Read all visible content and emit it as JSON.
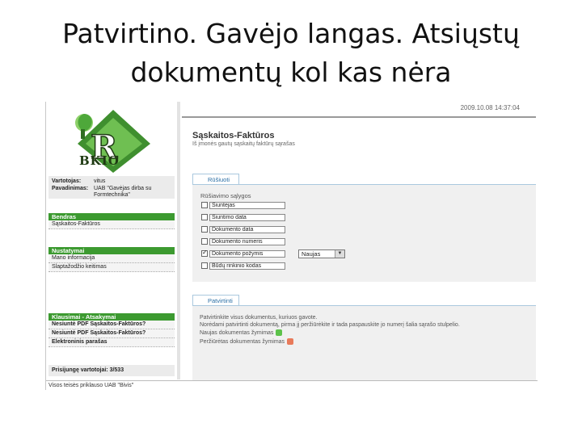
{
  "slide": {
    "title_line1": "Patvirtino. Gavėjo langas. Atsiųstų",
    "title_line2": "dokumentų kol kas nėra"
  },
  "app": {
    "timestamp": "2009.10.08 14:37:04",
    "logo_text": "BKIO",
    "footer": "Visos teisės priklauso UAB \"Bivis\""
  },
  "sidebar": {
    "user_label": "Vartotojas:",
    "user_value": "vitus",
    "company_label": "Pavadinimas:",
    "company_value": "UAB \"Gavėjas dirba su Formtechnika\"",
    "sections": [
      {
        "title": "Bendras",
        "items": [
          "Sąskaitos-Faktūros"
        ]
      },
      {
        "title": "Nustatymai",
        "items": [
          "Mano informacija",
          "Slaptažodžio keitimas"
        ]
      },
      {
        "title": "Klausimai - Atsakymai",
        "items": [
          "Nesiuntė PDF Sąskaitos-Faktūros?",
          "Nesiuntė PDF Sąskaitos-Faktūros?",
          "Elektroninis parašas"
        ]
      }
    ],
    "login_count": "Prisijungę vartotojai: 3/533"
  },
  "main": {
    "title": "Sąskaitos-Faktūros",
    "subtitle": "Iš įmonės gautų sąskaitų faktūrų sąrašas",
    "filter_tab": "Rūšiuoti",
    "filter_legend": "Rūšiavimo sąlygos",
    "criteria": [
      {
        "label": "Siuntėjas",
        "checked": false
      },
      {
        "label": "Siuntimo data",
        "checked": false
      },
      {
        "label": "Dokumento data",
        "checked": false
      },
      {
        "label": "Dokumento numeris",
        "checked": false
      },
      {
        "label": "Dokumento požymis",
        "checked": true
      },
      {
        "label": "Būdų rinkinio kodas",
        "checked": false
      }
    ],
    "status_select": "Naujas",
    "confirm_tab": "Patvirtinti",
    "info_lines": [
      "Patvirtinkite visus dokumentus, kuriuos gavote.",
      "Norėdami patvirtinti dokumentą, pirma jį peržiūrėkite ir tada paspauskite jo numerį šalia sąrašo stulpelio.",
      "Naujas dokumentas žymimas",
      "Peržiūrėtas dokumentas žymimas"
    ],
    "colors": {
      "new": "#5cc24a",
      "viewed": "#e87a5a"
    }
  }
}
